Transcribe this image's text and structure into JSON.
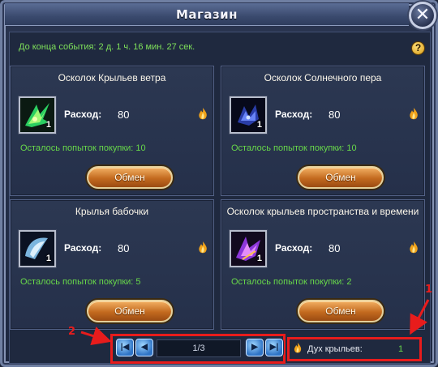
{
  "window": {
    "title": "Магазин"
  },
  "event": {
    "timer_text": "До конца события: 2 д. 1 ч. 16 мин. 27 сек."
  },
  "cost_label": "Расход:",
  "items": [
    {
      "name": "Осколок Крыльев ветра",
      "count": "1",
      "cost": "80",
      "attempts": "Осталось попыток покупки: 10",
      "button": "Обмен",
      "icon": "green-wing-shard-icon"
    },
    {
      "name": "Осколок Солнечного пера",
      "count": "1",
      "cost": "80",
      "attempts": "Осталось попыток покупки: 10",
      "button": "Обмен",
      "icon": "dark-blue-wing-icon"
    },
    {
      "name": "Крылья бабочки",
      "count": "1",
      "cost": "80",
      "attempts": "Осталось попыток покупки: 5",
      "button": "Обмен",
      "icon": "butterfly-wings-icon"
    },
    {
      "name": "Осколок крыльев пространства и времени",
      "count": "1",
      "cost": "80",
      "attempts": "Осталось попыток покупки: 2",
      "button": "Обмен",
      "icon": "purple-wing-shard-icon"
    }
  ],
  "pagination": {
    "page": "1/3"
  },
  "balance": {
    "label": "Дух крыльев:",
    "value": "1"
  },
  "annotations": {
    "marker_1": "1",
    "marker_2": "2"
  },
  "colors": {
    "annotation_red": "#e81c1c",
    "attempts_green": "#68d84a",
    "button_orange": "#c36a1f"
  }
}
